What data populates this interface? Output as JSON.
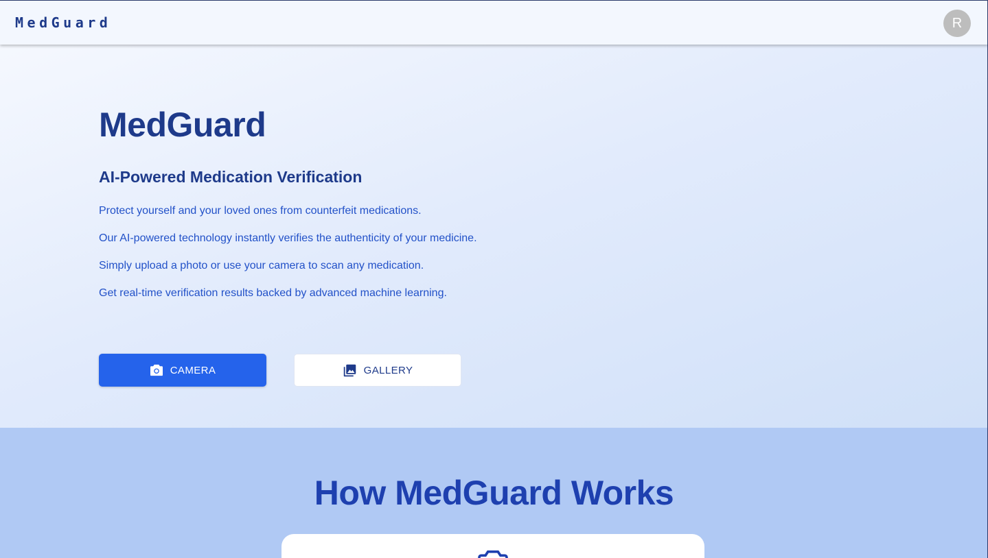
{
  "appbar": {
    "brand": "MedGuard",
    "avatar_initial": "R"
  },
  "hero": {
    "title": "MedGuard",
    "subtitle": "AI-Powered Medication Verification",
    "lines": [
      "Protect yourself and your loved ones from counterfeit medications.",
      "Our AI-powered technology instantly verifies the authenticity of your medicine.",
      "Simply upload a photo or use your camera to scan any medication.",
      "Get real-time verification results backed by advanced machine learning."
    ],
    "camera_button": {
      "label": "CAMERA",
      "icon": "camera-icon"
    },
    "gallery_button": {
      "label": "GALLERY",
      "icon": "photo-library-icon"
    }
  },
  "how": {
    "title": "How MedGuard Works",
    "card_icon": "camera-icon"
  },
  "colors": {
    "primary": "#2563eb",
    "heading": "#1e3a8a",
    "body_text": "#2251c8",
    "section_bg": "#b0c9f4"
  }
}
